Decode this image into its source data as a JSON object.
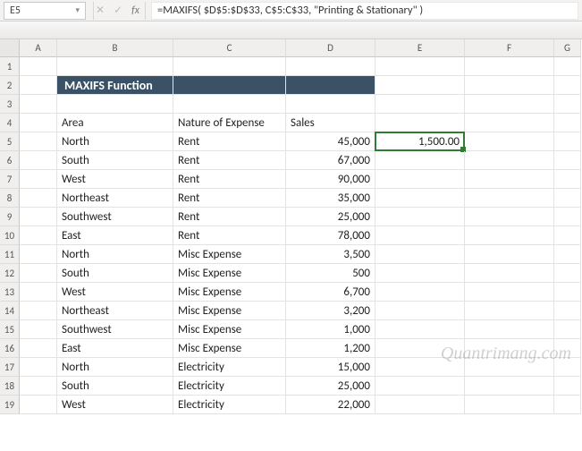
{
  "namebox": {
    "value": "E5"
  },
  "formula_bar": {
    "value": "=MAXIFS( $D$5:$D$33, C$5:C$33, \"Printing & Stationary\" )"
  },
  "icons": {
    "cancel": "✕",
    "confirm": "✓",
    "fx": "fx",
    "dropdown": "▾"
  },
  "columns": [
    "A",
    "B",
    "C",
    "D",
    "E",
    "F",
    "G"
  ],
  "title": "MAXIFS Function",
  "headers": {
    "area": "Area",
    "nature": "Nature of Expense",
    "sales": "Sales"
  },
  "selected": {
    "ref": "E5",
    "value": "1,500.00"
  },
  "watermark": "Quantrimang.com",
  "rows": [
    {
      "n": 1
    },
    {
      "n": 2,
      "title": true
    },
    {
      "n": 3
    },
    {
      "n": 4,
      "header": true
    },
    {
      "n": 5,
      "b": "North",
      "c": "Rent",
      "d": "45,000",
      "e": "1,500.00",
      "sel": true
    },
    {
      "n": 6,
      "b": "South",
      "c": "Rent",
      "d": "67,000"
    },
    {
      "n": 7,
      "b": "West",
      "c": "Rent",
      "d": "90,000"
    },
    {
      "n": 8,
      "b": "Northeast",
      "c": "Rent",
      "d": "35,000"
    },
    {
      "n": 9,
      "b": "Southwest",
      "c": "Rent",
      "d": "25,000"
    },
    {
      "n": 10,
      "b": "East",
      "c": "Rent",
      "d": "78,000"
    },
    {
      "n": 11,
      "b": "North",
      "c": "Misc Expense",
      "d": "3,500"
    },
    {
      "n": 12,
      "b": "South",
      "c": "Misc Expense",
      "d": "500"
    },
    {
      "n": 13,
      "b": "West",
      "c": "Misc Expense",
      "d": "6,700"
    },
    {
      "n": 14,
      "b": "Northeast",
      "c": "Misc Expense",
      "d": "3,200"
    },
    {
      "n": 15,
      "b": "Southwest",
      "c": "Misc Expense",
      "d": "1,000"
    },
    {
      "n": 16,
      "b": "East",
      "c": "Misc Expense",
      "d": "1,200"
    },
    {
      "n": 17,
      "b": "North",
      "c": "Electricity",
      "d": "15,000"
    },
    {
      "n": 18,
      "b": "South",
      "c": "Electricity",
      "d": "25,000"
    },
    {
      "n": 19,
      "b": "West",
      "c": "Electricity",
      "d": "22,000"
    }
  ],
  "chart_data": {
    "type": "table",
    "title": "MAXIFS Function",
    "columns": [
      "Area",
      "Nature of Expense",
      "Sales"
    ],
    "data": [
      [
        "North",
        "Rent",
        45000
      ],
      [
        "South",
        "Rent",
        67000
      ],
      [
        "West",
        "Rent",
        90000
      ],
      [
        "Northeast",
        "Rent",
        35000
      ],
      [
        "Southwest",
        "Rent",
        25000
      ],
      [
        "East",
        "Rent",
        78000
      ],
      [
        "North",
        "Misc Expense",
        3500
      ],
      [
        "South",
        "Misc Expense",
        500
      ],
      [
        "West",
        "Misc Expense",
        6700
      ],
      [
        "Northeast",
        "Misc Expense",
        3200
      ],
      [
        "Southwest",
        "Misc Expense",
        1000
      ],
      [
        "East",
        "Misc Expense",
        1200
      ],
      [
        "North",
        "Electricity",
        15000
      ],
      [
        "South",
        "Electricity",
        25000
      ],
      [
        "West",
        "Electricity",
        22000
      ]
    ],
    "result_cell": {
      "ref": "E5",
      "value": 1500.0,
      "formula": "=MAXIFS( $D$5:$D$33, C$5:C$33, \"Printing & Stationary\" )"
    }
  }
}
